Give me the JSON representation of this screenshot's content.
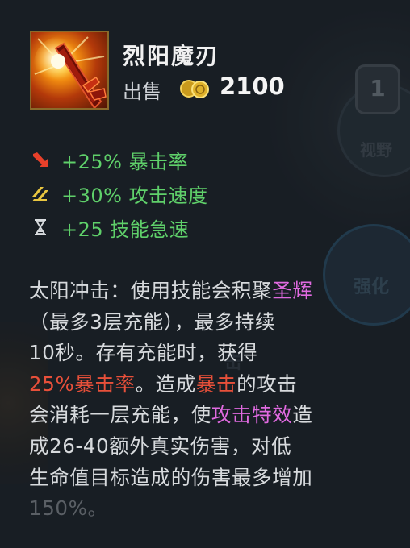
{
  "item": {
    "name": "烈阳魔刃",
    "sell_label": "出售",
    "sell_price": "2100",
    "icon": "sun-blade-icon",
    "currency_icon": "gold-coin-icon"
  },
  "stats": [
    {
      "icon": "crit-arrow-icon",
      "text": "+25% 暴击率"
    },
    {
      "icon": "attack-speed-icon",
      "text": "+30% 攻击速度"
    },
    {
      "icon": "hourglass-icon",
      "text": "+25 技能急速"
    }
  ],
  "description": {
    "line1": {
      "a": "太阳冲击：使用技能会积聚",
      "b": "圣辉"
    },
    "line2": "（最多3层充能），最多持续",
    "line3": "10秒。存有充能时，获得",
    "line4": {
      "a": "25%暴击率",
      "b": "。造成",
      "c": "暴击",
      "d": "的攻击"
    },
    "line5": {
      "a": "会消耗一层充能，使",
      "b": "攻击特效",
      "c": "造"
    },
    "line6": "成26-40额外真实伤害，对低",
    "line7": "生命值目标造成的伤害最多增加",
    "line8": "150%。"
  },
  "background": {
    "badge": "1",
    "label1": "视野",
    "label2": "强化",
    "label3": "击"
  },
  "colors": {
    "stat_green": "#5fd06a",
    "keyword_pink": "#e06ae0",
    "keyword_red": "#e8503a",
    "text": "#d7dadd"
  }
}
